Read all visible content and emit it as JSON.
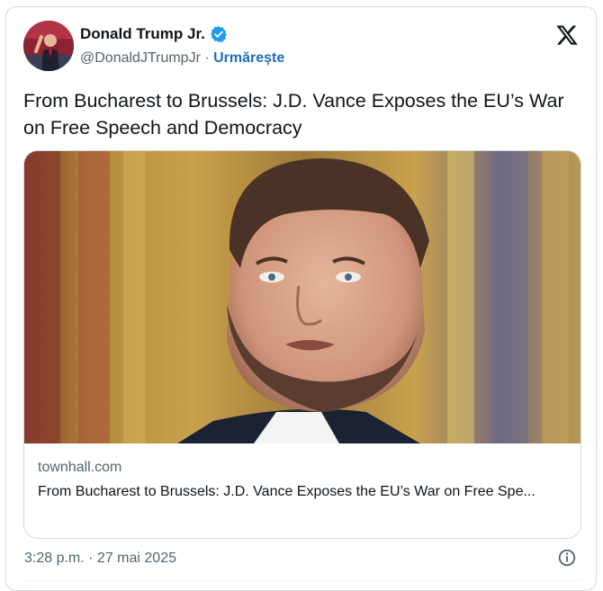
{
  "author": {
    "name": "Donald Trump Jr.",
    "handle": "@DonaldJTrumpJr",
    "separator": " · ",
    "follow_label": "Urmărește",
    "verified": true
  },
  "tweet": {
    "text": "From Bucharest to Brussels: J.D. Vance Exposes the EU’s War on Free Speech and Democracy"
  },
  "link_card": {
    "domain": "townhall.com",
    "title": "From Bucharest to Brussels: J.D. Vance Exposes the EU’s War on Free Spe..."
  },
  "meta": {
    "timestamp": "3:28 p.m. · 27 mai 2025"
  },
  "icons": {
    "verified": "verified-badge-icon",
    "platform": "x-logo-icon",
    "info": "info-icon"
  },
  "colors": {
    "verified_blue": "#1d9bf0",
    "follow_blue": "#1d6fb8",
    "secondary_text": "#536471"
  }
}
